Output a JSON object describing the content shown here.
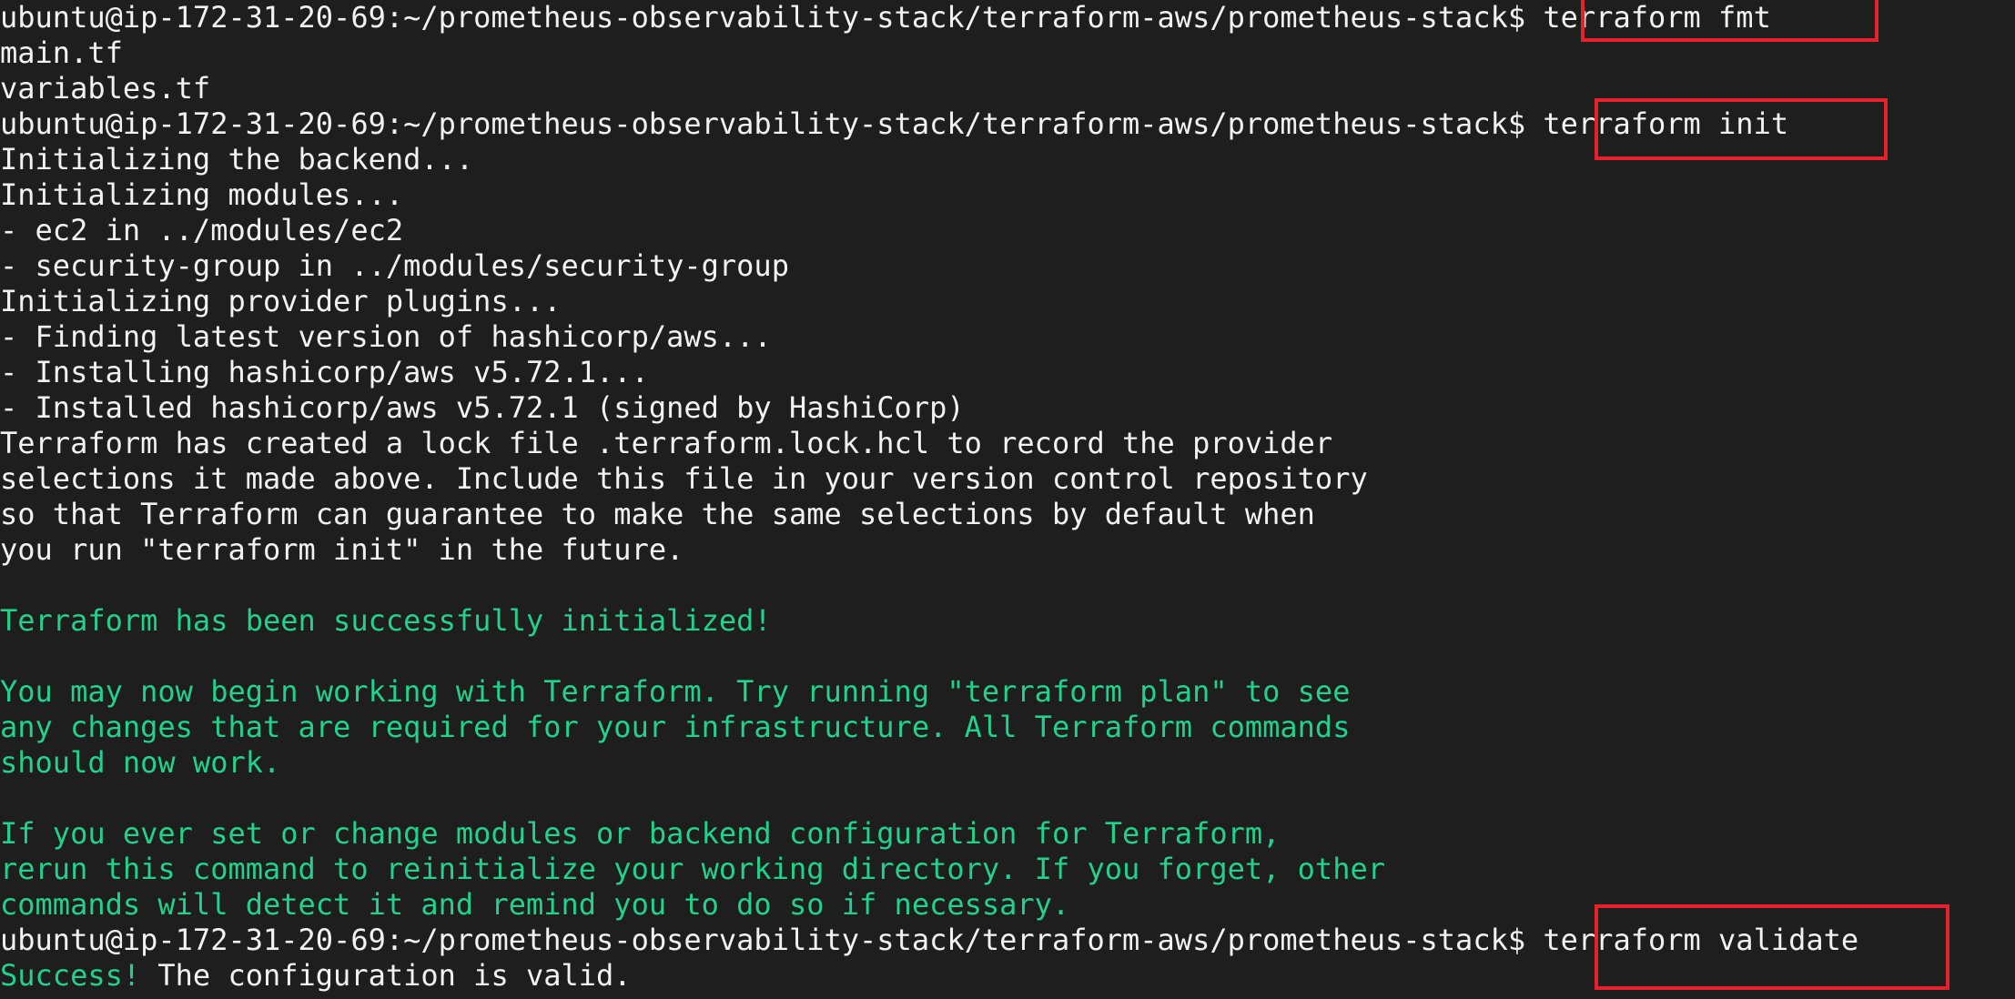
{
  "terminal": {
    "prompt": "ubuntu@ip-172-31-20-69:~/prometheus-observability-stack/terraform-aws/prometheus-stack$ ",
    "commands": {
      "fmt": "terraform fmt",
      "init": "terraform init",
      "validate": "terraform validate"
    },
    "fmt_output": [
      "main.tf",
      "variables.tf"
    ],
    "init_output": [
      "Initializing the backend...",
      "Initializing modules...",
      "- ec2 in ../modules/ec2",
      "- security-group in ../modules/security-group",
      "Initializing provider plugins...",
      "- Finding latest version of hashicorp/aws...",
      "- Installing hashicorp/aws v5.72.1...",
      "- Installed hashicorp/aws v5.72.1 (signed by HashiCorp)",
      "Terraform has created a lock file .terraform.lock.hcl to record the provider",
      "selections it made above. Include this file in your version control repository",
      "so that Terraform can guarantee to make the same selections by default when",
      "you run \"terraform init\" in the future."
    ],
    "init_success": "Terraform has been successfully initialized!",
    "init_next_steps": [
      "You may now begin working with Terraform. Try running \"terraform plan\" to see",
      "any changes that are required for your infrastructure. All Terraform commands",
      "should now work."
    ],
    "init_reinit_note": [
      "If you ever set or change modules or backend configuration for Terraform,",
      "rerun this command to reinitialize your working directory. If you forget, other",
      "commands will detect it and remind you to do so if necessary."
    ],
    "validate_success_word": "Success!",
    "validate_message": " The configuration is valid."
  },
  "colors": {
    "background": "#1e1e1e",
    "text": "#f2f2f2",
    "success_green": "#23d18b",
    "highlight_box": "#e8202a"
  }
}
